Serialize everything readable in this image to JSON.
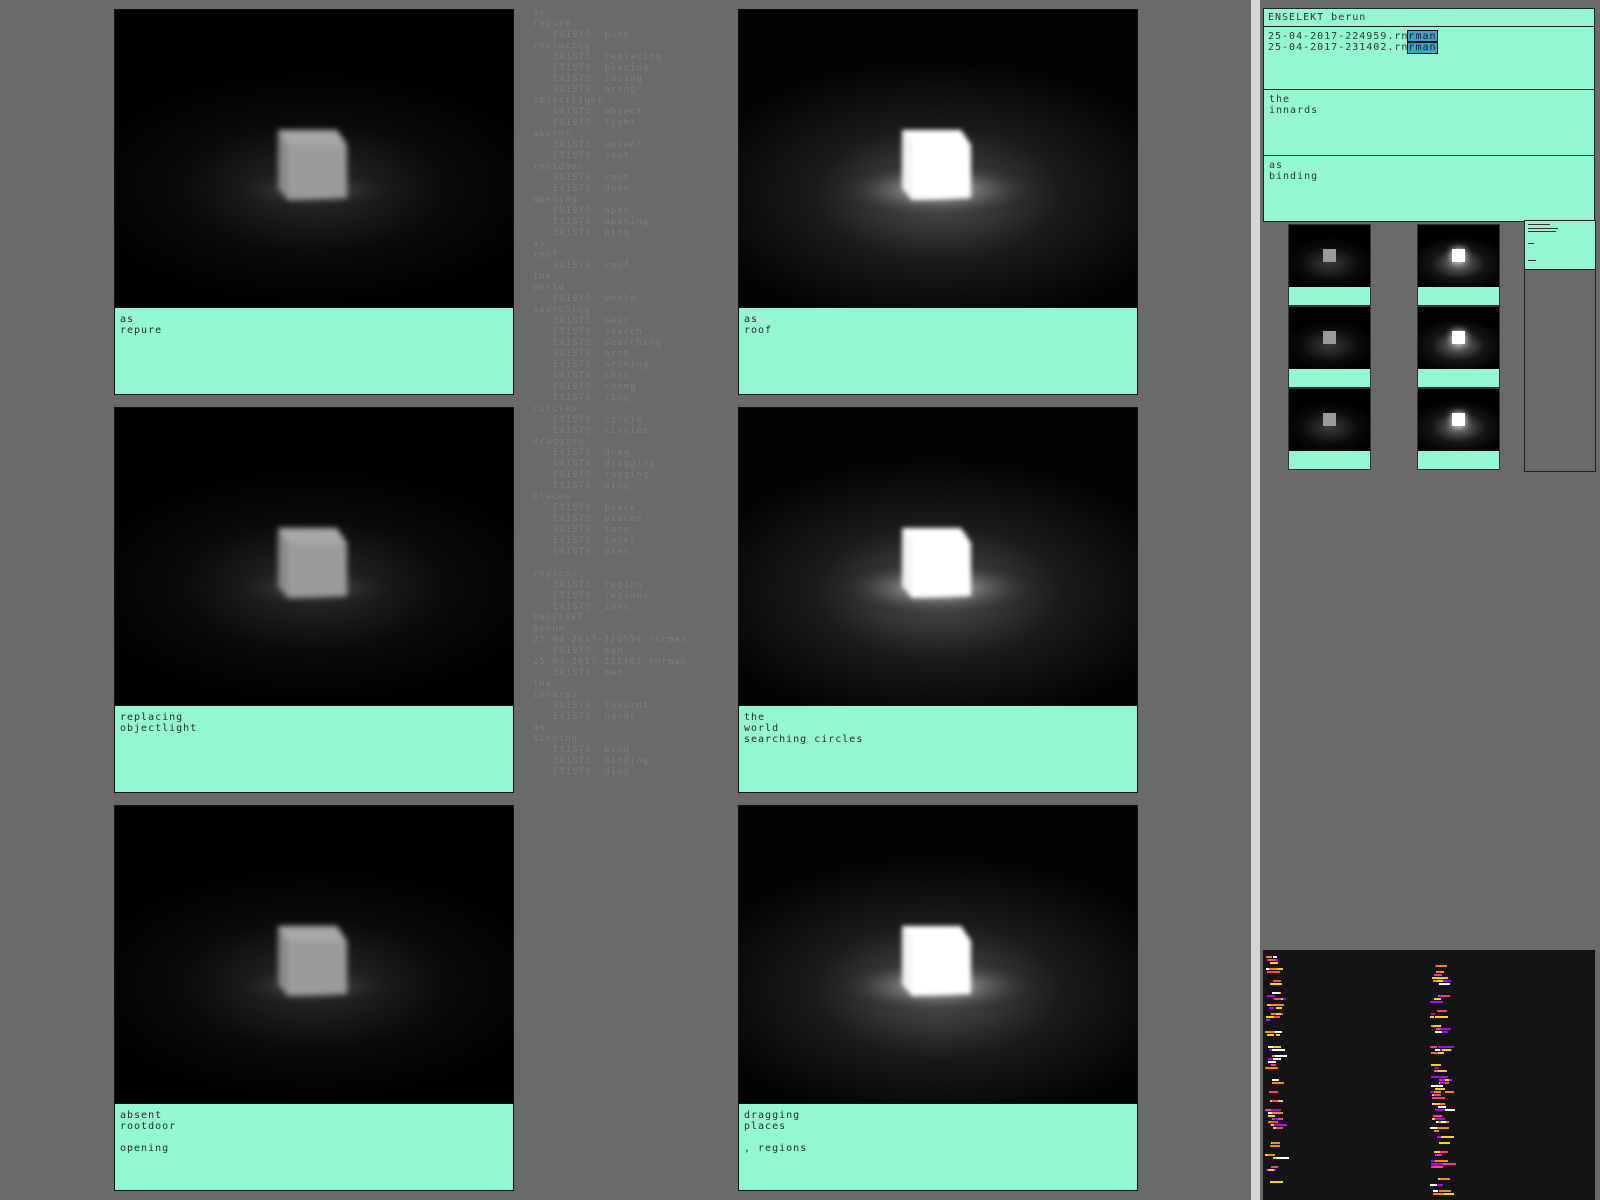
{
  "panels": [
    {
      "lines": [
        "as",
        "repure",
        "",
        ""
      ],
      "brightness": "dim"
    },
    {
      "lines": [
        "as",
        "roof",
        "",
        ""
      ],
      "brightness": "bright"
    },
    {
      "lines": [
        "replacing",
        "objectlight",
        "",
        ""
      ],
      "brightness": "dim"
    },
    {
      "lines": [
        "the",
        "world",
        "searching circles",
        ""
      ],
      "brightness": "bright"
    },
    {
      "lines": [
        "absent",
        "rootdoor",
        "",
        "opening"
      ],
      "brightness": "dim"
    },
    {
      "lines": [
        "dragging",
        "places",
        "",
        " , regions"
      ],
      "brightness": "bright"
    }
  ],
  "log": [
    {
      "t": "as",
      "i": false
    },
    {
      "t": "repure",
      "i": false
    },
    {
      "t": "EXISTS  pure",
      "i": true
    },
    {
      "t": "replacing",
      "i": false
    },
    {
      "t": "EXISTS  replacing",
      "i": true
    },
    {
      "t": "EXISTS  placing",
      "i": true
    },
    {
      "t": "EXISTS  lacing",
      "i": true
    },
    {
      "t": "EXISTS  acing",
      "i": true
    },
    {
      "t": "objectlight",
      "i": false
    },
    {
      "t": "EXISTS  object",
      "i": true
    },
    {
      "t": "EXISTS  light",
      "i": true
    },
    {
      "t": "absent",
      "i": false
    },
    {
      "t": "EXISTS  absent",
      "i": true
    },
    {
      "t": "EXISTS  sent",
      "i": true
    },
    {
      "t": "rootdoor",
      "i": false
    },
    {
      "t": "EXISTS  root",
      "i": true
    },
    {
      "t": "EXISTS  door",
      "i": true
    },
    {
      "t": "opening",
      "i": false
    },
    {
      "t": "EXISTS  open",
      "i": true
    },
    {
      "t": "EXISTS  opening",
      "i": true
    },
    {
      "t": "EXISTS  ping",
      "i": true
    },
    {
      "t": "as",
      "i": false
    },
    {
      "t": "roof",
      "i": false
    },
    {
      "t": "EXISTS  roof",
      "i": true
    },
    {
      "t": "the",
      "i": false
    },
    {
      "t": "world",
      "i": false
    },
    {
      "t": "EXISTS  world",
      "i": true
    },
    {
      "t": "searching",
      "i": false
    },
    {
      "t": "EXISTS  sear",
      "i": true
    },
    {
      "t": "EXISTS  search",
      "i": true
    },
    {
      "t": "EXISTS  searching",
      "i": true
    },
    {
      "t": "EXISTS  arch",
      "i": true
    },
    {
      "t": "EXISTS  arching",
      "i": true
    },
    {
      "t": "EXISTS  chin",
      "i": true
    },
    {
      "t": "EXISTS  ching",
      "i": true
    },
    {
      "t": "EXISTS  ring",
      "i": true
    },
    {
      "t": "circles",
      "i": false
    },
    {
      "t": "EXISTS  circle",
      "i": true
    },
    {
      "t": "EXISTS  circles",
      "i": true
    },
    {
      "t": "dragging",
      "i": false
    },
    {
      "t": "EXISTS  drag",
      "i": true
    },
    {
      "t": "EXISTS  dragging",
      "i": true
    },
    {
      "t": "EXISTS  ragging",
      "i": true
    },
    {
      "t": "EXISTS  ging",
      "i": true
    },
    {
      "t": "places",
      "i": false
    },
    {
      "t": "EXISTS  place",
      "i": true
    },
    {
      "t": "EXISTS  places",
      "i": true
    },
    {
      "t": "EXISTS  lace",
      "i": true
    },
    {
      "t": "EXISTS  laces",
      "i": true
    },
    {
      "t": "EXISTS  aces",
      "i": true
    },
    {
      "t": "",
      "i": false
    },
    {
      "t": "regions",
      "i": false
    },
    {
      "t": "EXISTS  region",
      "i": true
    },
    {
      "t": "EXISTS  regions",
      "i": true
    },
    {
      "t": "EXISTS  ions",
      "i": true
    },
    {
      "t": "ENSELEKT",
      "i": false
    },
    {
      "t": "berun",
      "i": false
    },
    {
      "t": "25-04-2017-224959.rnrman",
      "i": false
    },
    {
      "t": "EXISTS  man",
      "i": true
    },
    {
      "t": "25-04-2017-231402.rnrman",
      "i": false
    },
    {
      "t": "EXISTS  man",
      "i": true
    },
    {
      "t": "the",
      "i": false
    },
    {
      "t": "innards",
      "i": false
    },
    {
      "t": "EXISTS  innards",
      "i": true
    },
    {
      "t": "EXISTS  nards",
      "i": true
    },
    {
      "t": "as",
      "i": false
    },
    {
      "t": "binding",
      "i": false
    },
    {
      "t": "EXISTS  bind",
      "i": true
    },
    {
      "t": "EXISTS  binding",
      "i": true
    },
    {
      "t": "EXISTS  ding",
      "i": true
    }
  ],
  "sidebar": {
    "title": "ENSELEKT berun",
    "files": [
      {
        "name": "25-04-2017-224959.rn",
        "ext": "rman"
      },
      {
        "name": "25-04-2017-231402.rn",
        "ext": "rman"
      }
    ],
    "text1": [
      "the",
      "innards"
    ],
    "text2": [
      "as",
      "binding"
    ]
  },
  "thumbnails": [
    {
      "brightness": "dim"
    },
    {
      "brightness": "bright"
    },
    {
      "brightness": "dim"
    },
    {
      "brightness": "bright"
    },
    {
      "brightness": "dim"
    },
    {
      "brightness": "bright"
    }
  ],
  "track_colors": [
    "#ffd400",
    "#ff3d7f",
    "#ff8a00",
    "#b100ff",
    "#ffffff"
  ]
}
